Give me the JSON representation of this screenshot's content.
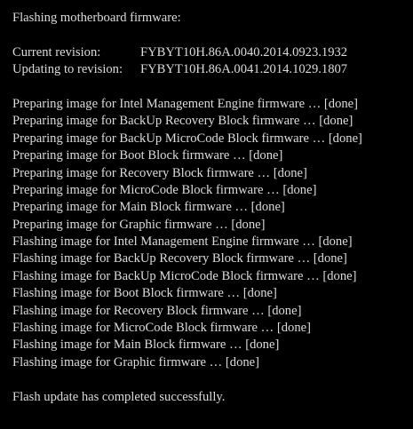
{
  "console": {
    "title": "Flashing motherboard firmware:",
    "current_label": "Current revision:",
    "current_value": "FYBYT10H.86A.0040.2014.0923.1932",
    "updating_label": "Updating to revision:",
    "updating_value": "FYBYT10H.86A.0041.2014.1029.1807",
    "log_lines": [
      "Preparing image for Intel Management Engine firmware … [done]",
      "Preparing image for BackUp Recovery Block firmware … [done]",
      "Preparing image for BackUp MicroCode Block firmware … [done]",
      "Preparing image for Boot Block firmware … [done]",
      "Preparing image for Recovery Block firmware … [done]",
      "Preparing image for MicroCode Block firmware … [done]",
      "Preparing image for Main Block firmware … [done]",
      "Preparing image for Graphic firmware … [done]",
      "Flashing image for Intel Management Engine firmware … [done]",
      "Flashing image for BackUp Recovery Block firmware … [done]",
      "Flashing image for BackUp MicroCode Block firmware … [done]",
      "Flashing image for Boot Block firmware … [done]",
      "Flashing image for Recovery Block firmware … [done]",
      "Flashing image for MicroCode Block firmware … [done]",
      "Flashing image for Main Block firmware … [done]",
      "Flashing image for Graphic firmware … [done]"
    ],
    "completion": "Flash update has completed successfully."
  },
  "colors": {
    "background": "#000000",
    "text": "#dcdcdc"
  }
}
